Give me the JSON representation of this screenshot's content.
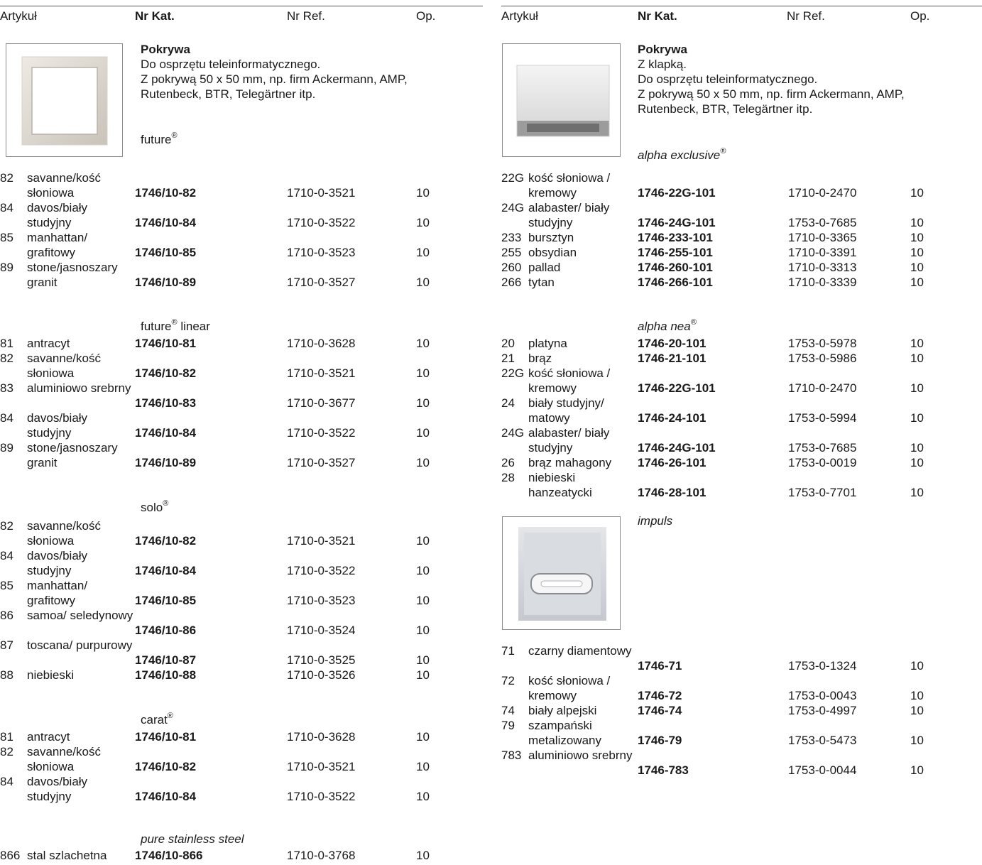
{
  "headers": {
    "article": "Artykuł",
    "cat": "Nr Kat.",
    "ref": "Nr Ref.",
    "op": "Op."
  },
  "left": {
    "product": {
      "title": "Pokrywa",
      "desc1": "Do osprzętu teleinformatycznego.",
      "desc2": "Z pokrywą 50 x 50 mm, np. firm Ackermann, AMP,",
      "desc3": "Rutenbeck, BTR, Telegärtner itp."
    },
    "groups": [
      {
        "series": "future",
        "reg": "®",
        "suffix": "",
        "rows": [
          {
            "code": "82",
            "name": "savanne/kość słoniowa",
            "cat": "1746/10-82",
            "ref": "1710-0-3521",
            "op": "10"
          },
          {
            "code": "84",
            "name": "davos/biały studyjny",
            "cat": "1746/10-84",
            "ref": "1710-0-3522",
            "op": "10"
          },
          {
            "code": "85",
            "name": "manhattan/ grafitowy",
            "cat": "1746/10-85",
            "ref": "1710-0-3523",
            "op": "10"
          },
          {
            "code": "89",
            "name": "stone/jasnoszary granit",
            "cat": "1746/10-89",
            "ref": "1710-0-3527",
            "op": "10"
          }
        ]
      },
      {
        "series": "future",
        "reg": "®",
        "suffix": " linear",
        "rows": [
          {
            "code": "81",
            "name": "antracyt",
            "cat": "1746/10-81",
            "ref": "1710-0-3628",
            "op": "10"
          },
          {
            "code": "82",
            "name": "savanne/kość słoniowa",
            "cat": "1746/10-82",
            "ref": "1710-0-3521",
            "op": "10"
          },
          {
            "code": "83",
            "name": "aluminiowo srebrny",
            "cat": "1746/10-83",
            "ref": "1710-0-3677",
            "op": "10"
          },
          {
            "code": "84",
            "name": "davos/biały studyjny",
            "cat": "1746/10-84",
            "ref": "1710-0-3522",
            "op": "10"
          },
          {
            "code": "89",
            "name": "stone/jasnoszary granit",
            "cat": "1746/10-89",
            "ref": "1710-0-3527",
            "op": "10"
          }
        ]
      },
      {
        "series": "solo",
        "reg": "®",
        "suffix": "",
        "rows": [
          {
            "code": "82",
            "name": "savanne/kość słoniowa",
            "cat": "1746/10-82",
            "ref": "1710-0-3521",
            "op": "10"
          },
          {
            "code": "84",
            "name": "davos/biały studyjny",
            "cat": "1746/10-84",
            "ref": "1710-0-3522",
            "op": "10"
          },
          {
            "code": "85",
            "name": "manhattan/ grafitowy",
            "cat": "1746/10-85",
            "ref": "1710-0-3523",
            "op": "10"
          },
          {
            "code": "86",
            "name": "samoa/ seledynowy",
            "cat": "1746/10-86",
            "ref": "1710-0-3524",
            "op": "10"
          },
          {
            "code": "87",
            "name": "toscana/ purpurowy",
            "cat": "1746/10-87",
            "ref": "1710-0-3525",
            "op": "10"
          },
          {
            "code": "88",
            "name": "niebieski",
            "cat": "1746/10-88",
            "ref": "1710-0-3526",
            "op": "10"
          }
        ]
      },
      {
        "series": "carat",
        "reg": "®",
        "suffix": "",
        "rows": [
          {
            "code": "81",
            "name": "antracyt",
            "cat": "1746/10-81",
            "ref": "1710-0-3628",
            "op": "10"
          },
          {
            "code": "82",
            "name": "savanne/kość słoniowa",
            "cat": "1746/10-82",
            "ref": "1710-0-3521",
            "op": "10"
          },
          {
            "code": "84",
            "name": "davos/biały studyjny",
            "cat": "1746/10-84",
            "ref": "1710-0-3522",
            "op": "10"
          }
        ]
      },
      {
        "series": "pure stainless steel",
        "reg": "",
        "suffix": "",
        "rows": [
          {
            "code": "866",
            "name": "stal szlachetna",
            "cat": "1746/10-866",
            "ref": "1710-0-3768",
            "op": "10"
          }
        ]
      }
    ]
  },
  "right": {
    "product": {
      "title": "Pokrywa",
      "desc0": "Z klapką.",
      "desc1": "Do osprzętu teleinformatycznego.",
      "desc2": "Z pokrywą 50 x 50 mm, np. firm Ackermann, AMP,",
      "desc3": "Rutenbeck, BTR, Telegärtner itp."
    },
    "groups": [
      {
        "series": "alpha exclusive",
        "reg": "®",
        "suffix": "",
        "rows": [
          {
            "code": "22G",
            "name": "kość słoniowa / kremowy",
            "cat": "1746-22G-101",
            "ref": "1710-0-2470",
            "op": "10"
          },
          {
            "code": "24G",
            "name": "alabaster/ biały studyjny",
            "cat": "1746-24G-101",
            "ref": "1753-0-7685",
            "op": "10"
          },
          {
            "code": "233",
            "name": "bursztyn",
            "cat": "1746-233-101",
            "ref": "1710-0-3365",
            "op": "10"
          },
          {
            "code": "255",
            "name": "obsydian",
            "cat": "1746-255-101",
            "ref": "1710-0-3391",
            "op": "10"
          },
          {
            "code": "260",
            "name": "pallad",
            "cat": "1746-260-101",
            "ref": "1710-0-3313",
            "op": "10"
          },
          {
            "code": "266",
            "name": "tytan",
            "cat": "1746-266-101",
            "ref": "1710-0-3339",
            "op": "10"
          }
        ]
      },
      {
        "series": "alpha nea",
        "reg": "®",
        "suffix": "",
        "rows": [
          {
            "code": "20",
            "name": "platyna",
            "cat": "1746-20-101",
            "ref": "1753-0-5978",
            "op": "10"
          },
          {
            "code": "21",
            "name": "brąz",
            "cat": "1746-21-101",
            "ref": "1753-0-5986",
            "op": "10"
          },
          {
            "code": "22G",
            "name": "kość słoniowa / kremowy",
            "cat": "1746-22G-101",
            "ref": "1710-0-2470",
            "op": "10"
          },
          {
            "code": "24",
            "name": "biały studyjny/ matowy",
            "cat": "1746-24-101",
            "ref": "1753-0-5994",
            "op": "10"
          },
          {
            "code": "24G",
            "name": "alabaster/ biały studyjny",
            "cat": "1746-24G-101",
            "ref": "1753-0-7685",
            "op": "10"
          },
          {
            "code": "26",
            "name": "brąz mahagony",
            "cat": "1746-26-101",
            "ref": "1753-0-0019",
            "op": "10"
          },
          {
            "code": "28",
            "name": "niebieski hanzeatycki",
            "cat": "1746-28-101",
            "ref": "1753-0-7701",
            "op": "10"
          }
        ]
      },
      {
        "series": "impuls",
        "reg": "",
        "suffix": "",
        "rows": [
          {
            "code": "71",
            "name": "czarny diamentowy",
            "cat": "1746-71",
            "ref": "1753-0-1324",
            "op": "10"
          },
          {
            "code": "72",
            "name": "kość słoniowa / kremowy",
            "cat": "1746-72",
            "ref": "1753-0-0043",
            "op": "10"
          },
          {
            "code": "74",
            "name": "biały alpejski",
            "cat": "1746-74",
            "ref": "1753-0-4997",
            "op": "10"
          },
          {
            "code": "79",
            "name": "szampański metalizowany",
            "cat": "1746-79",
            "ref": "1753-0-5473",
            "op": "10"
          },
          {
            "code": "783",
            "name": "aluminiowo srebrny",
            "cat": "1746-783",
            "ref": "1753-0-0044",
            "op": "10"
          }
        ]
      }
    ]
  }
}
